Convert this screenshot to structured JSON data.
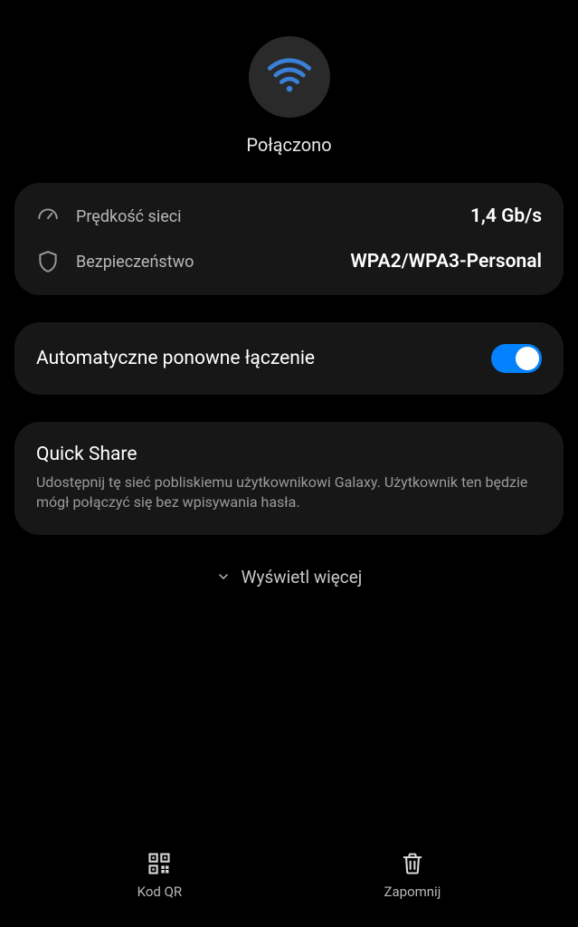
{
  "header": {
    "status": "Połączono"
  },
  "info": {
    "speed": {
      "label": "Prędkość sieci",
      "value": "1,4 Gb/s"
    },
    "security": {
      "label": "Bezpieczeństwo",
      "value": "WPA2/WPA3-Personal"
    }
  },
  "autoReconnect": {
    "label": "Automatyczne ponowne łączenie",
    "enabled": true
  },
  "quickShare": {
    "title": "Quick Share",
    "description": "Udostępnij tę sieć pobliskiemu użytkownikowi Galaxy. Użytkownik ten będzie mógł połączyć się bez wpisywania hasła."
  },
  "showMore": {
    "label": "Wyświetl więcej"
  },
  "bottomActions": {
    "qrCode": {
      "label": "Kod QR"
    },
    "forget": {
      "label": "Zapomnij"
    }
  },
  "colors": {
    "accent": "#0381fe",
    "wifiIcon": "#3b7fd6"
  }
}
